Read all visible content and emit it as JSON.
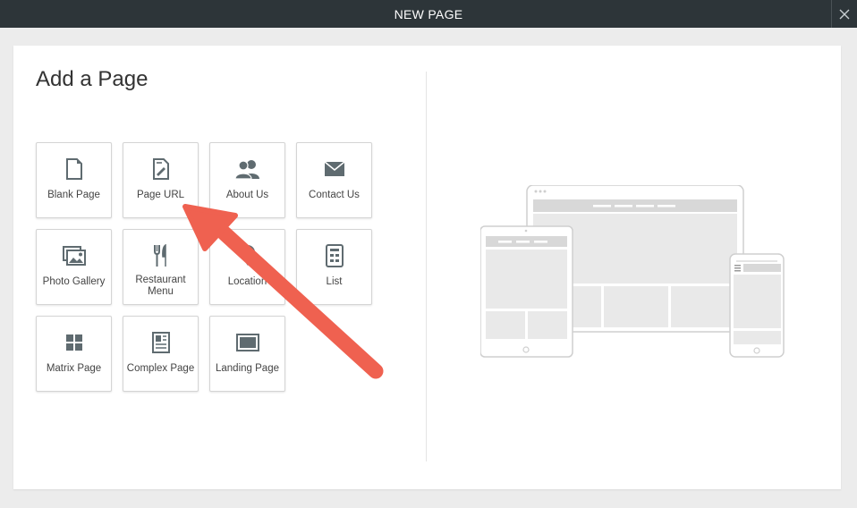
{
  "window": {
    "title": "NEW PAGE"
  },
  "panel": {
    "heading": "Add a Page"
  },
  "tiles": [
    {
      "label": "Blank Page",
      "icon": "blank-page-icon"
    },
    {
      "label": "Page URL",
      "icon": "page-url-icon"
    },
    {
      "label": "About Us",
      "icon": "people-icon"
    },
    {
      "label": "Contact Us",
      "icon": "envelope-icon"
    },
    {
      "label": "Photo Gallery",
      "icon": "photo-gallery-icon"
    },
    {
      "label": "Restaurant Menu",
      "icon": "fork-knife-icon"
    },
    {
      "label": "Location",
      "icon": "location-pin-icon"
    },
    {
      "label": "List",
      "icon": "list-icon"
    },
    {
      "label": "Matrix Page",
      "icon": "matrix-icon"
    },
    {
      "label": "Complex Page",
      "icon": "complex-page-icon"
    },
    {
      "label": "Landing Page",
      "icon": "landing-page-icon"
    }
  ],
  "colors": {
    "titlebar": "#2d3539",
    "icon": "#5f6b70",
    "arrow": "#ef6150",
    "device_outline": "#cfcfcf",
    "device_fill": "#e9e9e9"
  }
}
